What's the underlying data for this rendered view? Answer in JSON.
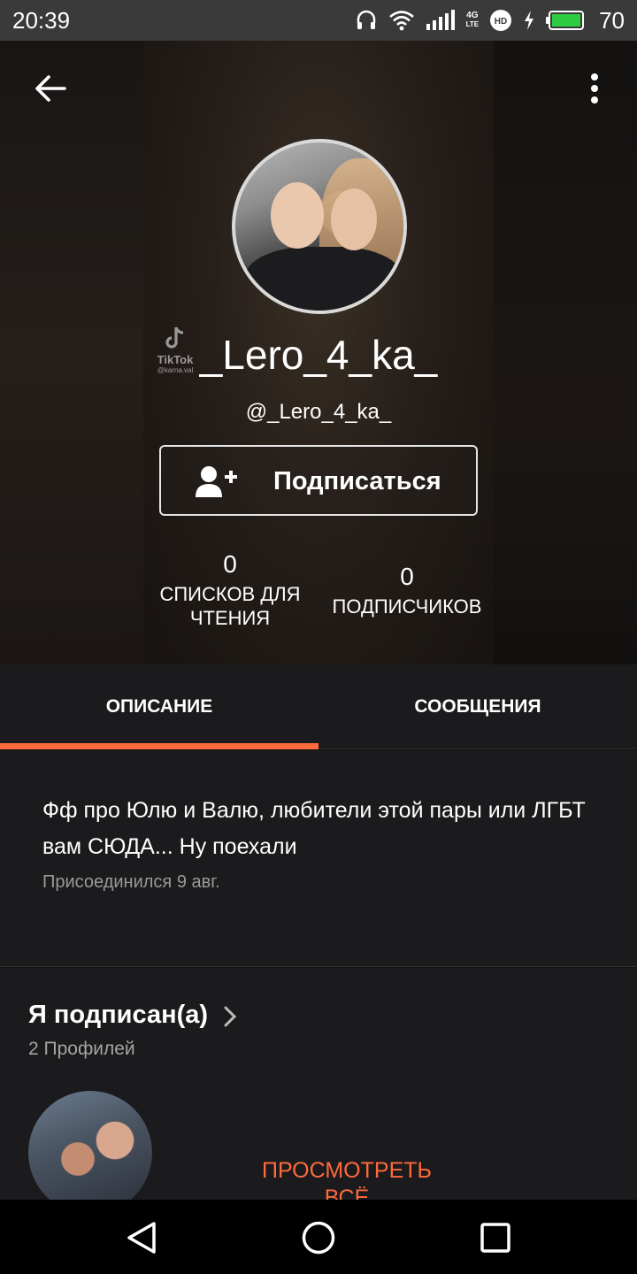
{
  "status_bar": {
    "time": "20:39",
    "battery_level": "70",
    "network_label": "4G",
    "icons": [
      "headphones-icon",
      "wifi-icon",
      "signal-icon",
      "4g-lte-icon",
      "hd-icon",
      "charging-icon",
      "battery-icon"
    ]
  },
  "header": {
    "watermark": "TikTok",
    "watermark_sub": "@karna.val",
    "display_name": "_Lero_4_ka_",
    "handle": "@_Lero_4_ka_",
    "follow_button": "Подписаться",
    "stats": {
      "reading_lists_count": "0",
      "reading_lists_label": "СПИСКОВ ДЛЯ ЧТЕНИЯ",
      "followers_count": "0",
      "followers_label": "ПОДПИСЧИКОВ"
    }
  },
  "tabs": [
    {
      "label": "ОПИСАНИЕ",
      "active": true
    },
    {
      "label": "СООБЩЕНИЯ",
      "active": false
    }
  ],
  "description": {
    "text": "Фф про Юлю и Валю, любители этой пары или ЛГБТ вам СЮДА... Ну поехали",
    "joined": "Присоединился 9 авг."
  },
  "following": {
    "title": "Я подписан(а)",
    "count": "2 Профилей",
    "view_all": "ПРОСМОТРЕТЬ ВСЁ"
  },
  "colors": {
    "accent": "#ff6a3d",
    "background": "#1b1a1c",
    "status_bar": "#3a3a3a",
    "battery": "#2ecc40"
  }
}
